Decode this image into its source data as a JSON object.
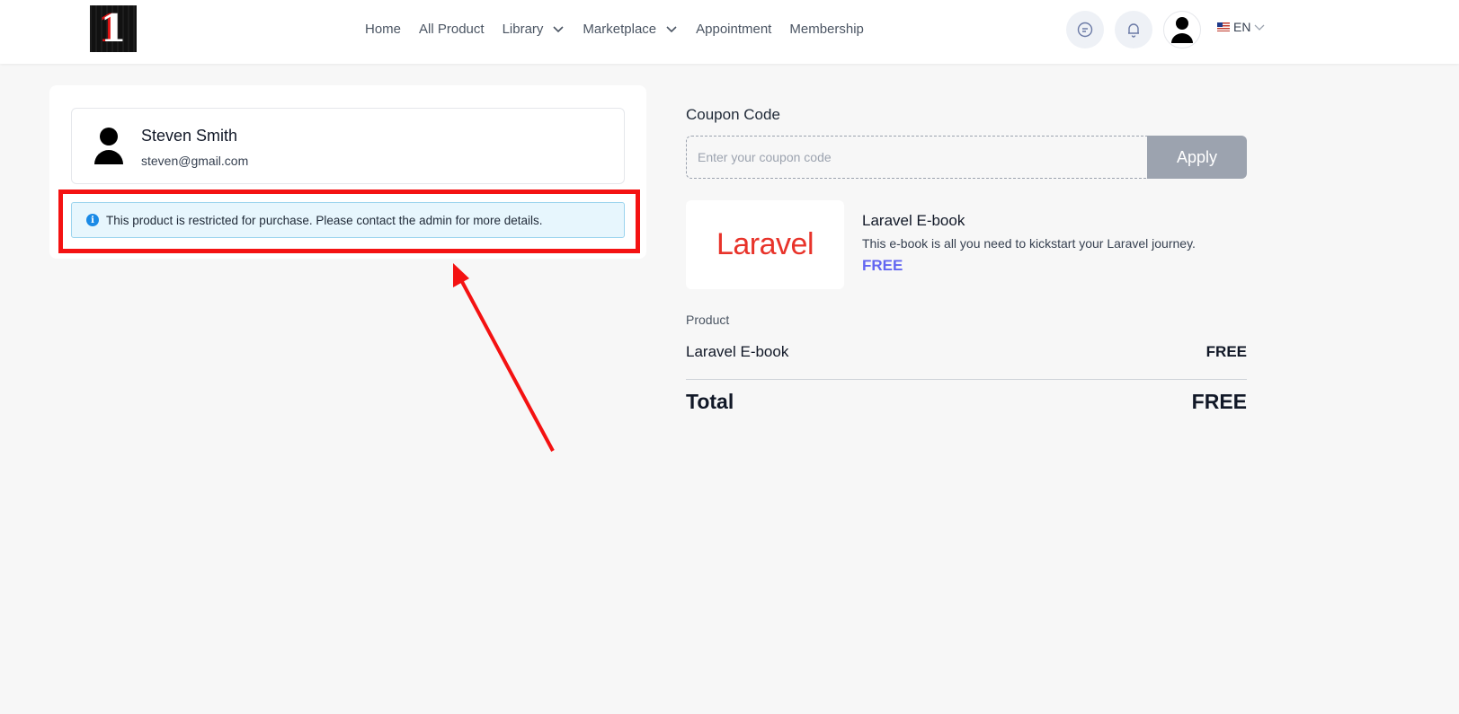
{
  "header": {
    "logo_text": "1",
    "nav": [
      {
        "label": "Home",
        "has_dropdown": false
      },
      {
        "label": "All Product",
        "has_dropdown": false
      },
      {
        "label": "Library",
        "has_dropdown": true
      },
      {
        "label": "Marketplace",
        "has_dropdown": true
      },
      {
        "label": "Appointment",
        "has_dropdown": false
      },
      {
        "label": "Membership",
        "has_dropdown": false
      }
    ],
    "icons": [
      "chat-icon",
      "bell-icon",
      "user-avatar-icon"
    ],
    "language": "EN"
  },
  "user": {
    "name": "Steven Smith",
    "email": "steven@gmail.com"
  },
  "alert": {
    "message": "This product is restricted for purchase. Please contact the admin for more details.",
    "type": "info"
  },
  "coupon": {
    "title": "Coupon Code",
    "placeholder": "Enter your coupon code",
    "value": "",
    "apply_label": "Apply"
  },
  "product": {
    "brand": "Laravel",
    "title": "Laravel E-book",
    "description": "This e-book is all you need to kickstart your Laravel journey.",
    "price": "FREE"
  },
  "summary": {
    "label": "Product",
    "line_name": "Laravel E-book",
    "line_price": "FREE",
    "total_label": "Total",
    "total_value": "FREE"
  },
  "colors": {
    "accent_price": "#6366f1",
    "annotation_red": "#f41212",
    "apply_button": "#9ca3af",
    "laravel_red": "#e8332a",
    "alert_bg": "#e7f6fd"
  }
}
